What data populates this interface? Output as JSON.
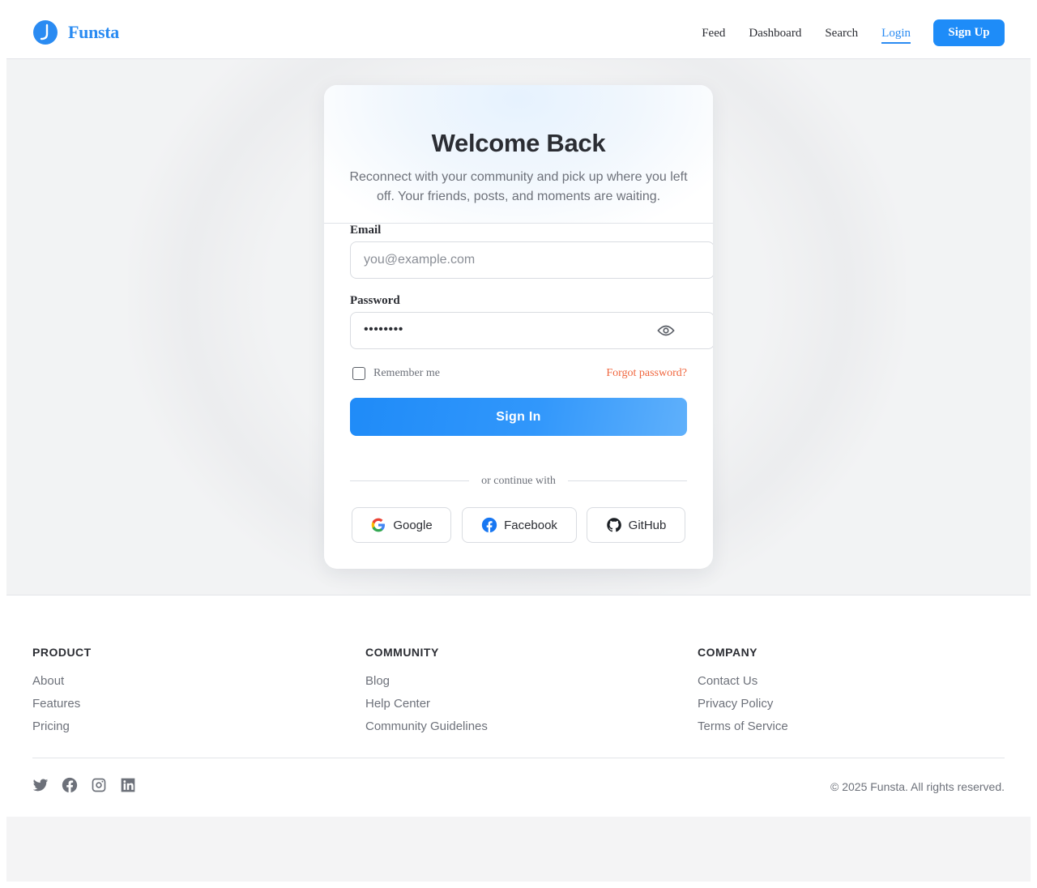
{
  "brand": {
    "name": "Funsta",
    "color": "#2a8bf2"
  },
  "nav": {
    "links": [
      "Feed",
      "Dashboard",
      "Search",
      "Login"
    ],
    "active": "Login",
    "signup_label": "Sign Up"
  },
  "login": {
    "title": "Welcome Back",
    "subtitle": "Reconnect with your community and pick up where you left off. Your friends, posts, and moments are waiting.",
    "email_label": "Email",
    "email_placeholder": "you@example.com",
    "password_label": "Password",
    "password_value": "••••••••",
    "remember_label": "Remember me",
    "remember_checked": false,
    "forgot_label": "Forgot password?",
    "signin_label": "Sign In",
    "divider_text": "or continue with",
    "social": [
      {
        "label": "Google",
        "icon": "google-icon"
      },
      {
        "label": "Facebook",
        "icon": "facebook-icon"
      },
      {
        "label": "GitHub",
        "icon": "github-icon"
      }
    ]
  },
  "footer": {
    "columns": [
      {
        "heading": "PRODUCT",
        "links": [
          "About",
          "Features",
          "Pricing"
        ]
      },
      {
        "heading": "COMMUNITY",
        "links": [
          "Blog",
          "Help Center",
          "Community Guidelines"
        ]
      },
      {
        "heading": "COMPANY",
        "links": [
          "Contact Us",
          "Privacy Policy",
          "Terms of Service"
        ]
      }
    ],
    "social_icons": [
      "twitter-icon",
      "facebook-icon",
      "instagram-icon",
      "linkedin-icon"
    ],
    "copyright": "© 2025 Funsta. All rights reserved."
  },
  "colors": {
    "primary": "#1e8cf8",
    "forgot": "#f0673f",
    "text": "#2b2d33",
    "muted": "#6d717a"
  }
}
